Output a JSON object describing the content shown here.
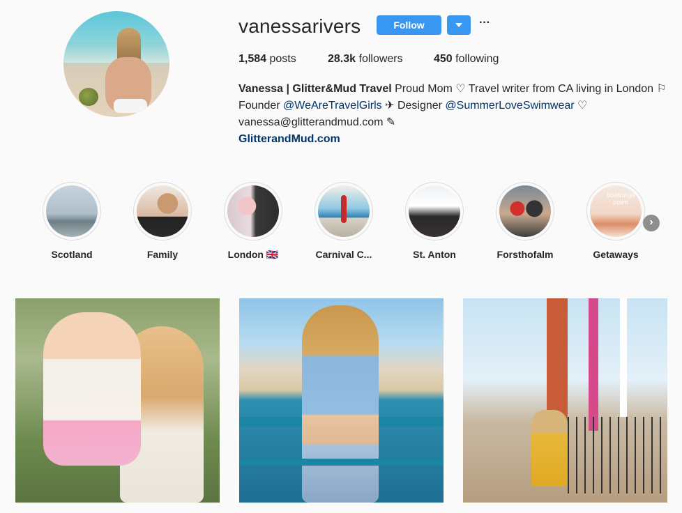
{
  "profile": {
    "username": "vanessarivers",
    "follow_label": "Follow",
    "more_label": "···",
    "stats": {
      "posts_count": "1,584",
      "posts_label": " posts",
      "followers_count": "28.3k",
      "followers_label": " followers",
      "following_count": "450",
      "following_label": " following"
    },
    "bio": {
      "name": "Vanessa | Glitter&Mud Travel",
      "line1_rest": " Proud Mom ♡ Travel writer from CA living in London ⚐",
      "line2_prefix": "Founder ",
      "mention1": "@WeAreTravelGirls",
      "line2_middle": " ✈ Designer ",
      "mention2": "@SummerLoveSwimwear",
      "line2_suffix": " ♡",
      "email_line": "vanessa@glitterandmud.com ✎",
      "website": "GlitterandMud.com"
    }
  },
  "highlights": [
    {
      "label": "Scotland"
    },
    {
      "label": "Family"
    },
    {
      "label": "London 🇬🇧"
    },
    {
      "label": "Carnival C..."
    },
    {
      "label": "St. Anton"
    },
    {
      "label": "Forsthofalm"
    },
    {
      "label": "Getaways",
      "cover_text": "bookings open"
    }
  ],
  "navigation": {
    "next_arrow": "›"
  },
  "colors": {
    "follow_button": "#3897f0",
    "mention_link": "#003569",
    "text": "#262626",
    "background": "#fafafa"
  }
}
